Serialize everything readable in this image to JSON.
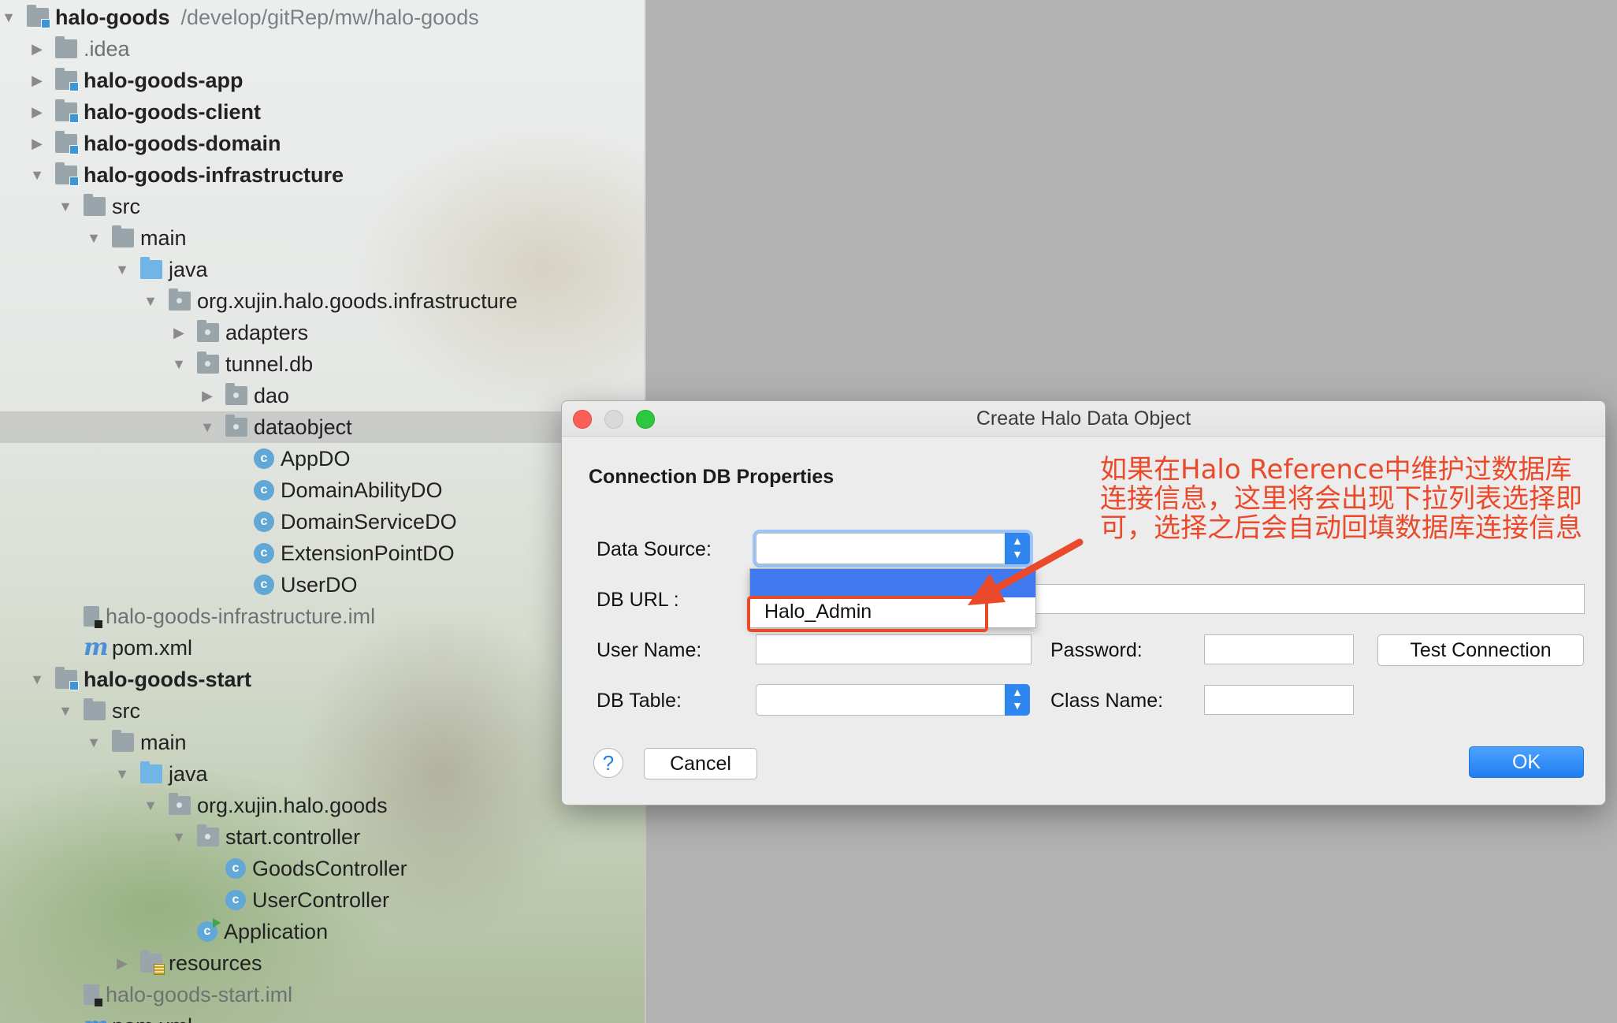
{
  "tree": {
    "root": {
      "name": "halo-goods",
      "path": "/develop/gitRep/mw/halo-goods"
    },
    "items": [
      {
        "label": "halo-goods",
        "icon": "module-folder-icon",
        "expanded": true
      },
      {
        "label": ".idea",
        "icon": "folder-icon",
        "expanded": false
      },
      {
        "label": "halo-goods-app",
        "icon": "module-folder-icon",
        "expanded": false
      },
      {
        "label": "halo-goods-client",
        "icon": "module-folder-icon",
        "expanded": false
      },
      {
        "label": "halo-goods-domain",
        "icon": "module-folder-icon",
        "expanded": false
      },
      {
        "label": "halo-goods-infrastructure",
        "icon": "module-folder-icon",
        "expanded": true
      },
      {
        "label": "src",
        "icon": "folder-icon",
        "expanded": true
      },
      {
        "label": "main",
        "icon": "folder-icon",
        "expanded": true
      },
      {
        "label": "java",
        "icon": "source-folder-icon",
        "expanded": true
      },
      {
        "label": "org.xujin.halo.goods.infrastructure",
        "icon": "package-icon",
        "expanded": true
      },
      {
        "label": "adapters",
        "icon": "package-icon",
        "expanded": false
      },
      {
        "label": "tunnel.db",
        "icon": "package-icon",
        "expanded": true
      },
      {
        "label": "dao",
        "icon": "package-icon",
        "expanded": false
      },
      {
        "label": "dataobject",
        "icon": "package-icon",
        "expanded": true
      },
      {
        "label": "AppDO",
        "icon": "class-icon"
      },
      {
        "label": "DomainAbilityDO",
        "icon": "class-icon"
      },
      {
        "label": "DomainServiceDO",
        "icon": "class-icon"
      },
      {
        "label": "ExtensionPointDO",
        "icon": "class-icon"
      },
      {
        "label": "UserDO",
        "icon": "class-icon"
      },
      {
        "label": "halo-goods-infrastructure.iml",
        "icon": "iml-file-icon"
      },
      {
        "label": "pom.xml",
        "icon": "maven-icon"
      },
      {
        "label": "halo-goods-start",
        "icon": "module-folder-icon",
        "expanded": true
      },
      {
        "label": "src",
        "icon": "folder-icon",
        "expanded": true
      },
      {
        "label": "main",
        "icon": "folder-icon",
        "expanded": true
      },
      {
        "label": "java",
        "icon": "source-folder-icon",
        "expanded": true
      },
      {
        "label": "org.xujin.halo.goods",
        "icon": "package-icon",
        "expanded": true
      },
      {
        "label": "start.controller",
        "icon": "package-icon",
        "expanded": true
      },
      {
        "label": "GoodsController",
        "icon": "class-icon"
      },
      {
        "label": "UserController",
        "icon": "class-icon"
      },
      {
        "label": "Application",
        "icon": "spring-app-icon"
      },
      {
        "label": "resources",
        "icon": "resources-folder-icon",
        "expanded": false
      },
      {
        "label": "halo-goods-start.iml",
        "icon": "iml-file-icon"
      },
      {
        "label": "pom.xml",
        "icon": "maven-icon"
      }
    ]
  },
  "dialog": {
    "title": "Create Halo Data Object",
    "section_title": "Connection DB Properties",
    "labels": {
      "data_source": "Data Source:",
      "db_url": "DB   URL :",
      "user_name": "User Name:",
      "password": "Password:",
      "db_table": "DB  Table:",
      "class_name": "Class Name:"
    },
    "values": {
      "data_source": "",
      "db_url": "",
      "user_name": "",
      "password": "",
      "db_table": "",
      "class_name": ""
    },
    "dropdown_options": [
      "",
      "Halo_Admin"
    ],
    "buttons": {
      "test_connection": "Test Connection",
      "cancel": "Cancel",
      "ok": "OK",
      "help": "?"
    }
  },
  "annotation": {
    "text": "如果在Halo Reference中维护过数据库连接信息，这里将会出现下拉列表选择即可，选择之后会自动回填数据库连接信息",
    "color": "#ea4a2a"
  },
  "colors": {
    "accent": "#2f86ee",
    "annotation": "#ea4a2a",
    "selection": "#3f78ef"
  }
}
